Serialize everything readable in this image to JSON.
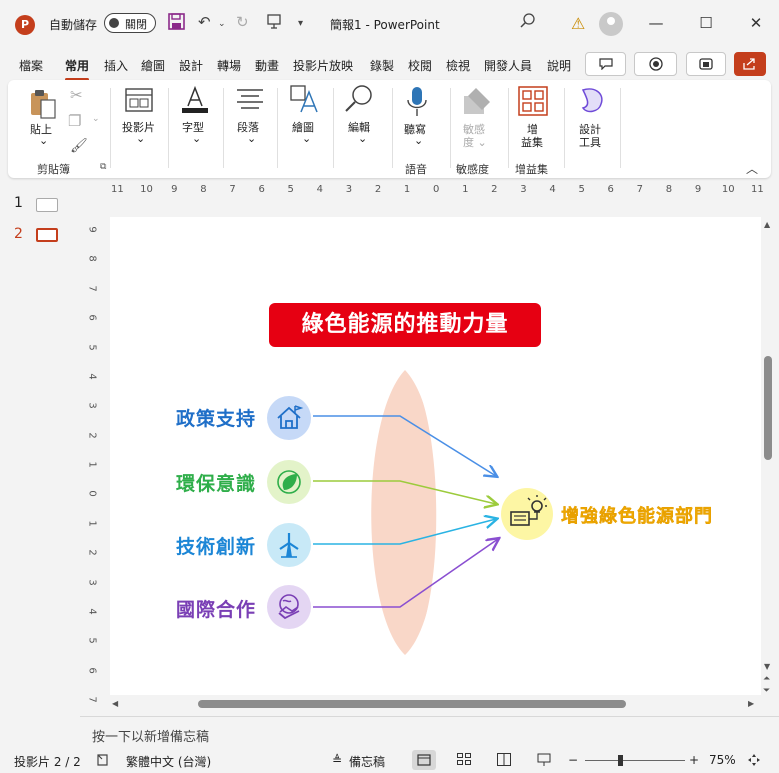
{
  "titlebar": {
    "app_logo": "P",
    "autosave_label": "自動儲存",
    "autosave_state": "關閉",
    "doc_title": "簡報1  -  PowerPoint"
  },
  "tabs": [
    "檔案",
    "常用",
    "插入",
    "繪圖",
    "設計",
    "轉場",
    "動畫",
    "投影片放映",
    "錄製",
    "校閱",
    "檢視",
    "開發人員",
    "說明"
  ],
  "active_tab": "常用",
  "ribbon": {
    "paste": "貼上",
    "clipboard_group": "剪貼簿",
    "slides": "投影片",
    "font": "字型",
    "paragraph": "段落",
    "drawing": "繪圖",
    "editing": "編輯",
    "dictate": "聽寫",
    "voice_group": "語音",
    "sensitivity_line1": "敏感",
    "sensitivity_line2": "度",
    "sensitivity_group": "敏感度",
    "addins_line1": "增",
    "addins_line2": "益集",
    "addins_group": "增益集",
    "designer_line1": "設計",
    "designer_line2": "工具"
  },
  "ruler": {
    "h_ticks": [
      "11",
      "10",
      "9",
      "8",
      "7",
      "6",
      "5",
      "4",
      "3",
      "2",
      "1",
      "0",
      "1",
      "2",
      "3",
      "4",
      "5",
      "6",
      "7",
      "8",
      "9",
      "10",
      "11"
    ],
    "v_ticks": [
      "9",
      "8",
      "7",
      "6",
      "5",
      "4",
      "3",
      "2",
      "1",
      "0",
      "1",
      "2",
      "3",
      "4",
      "5",
      "6",
      "7"
    ]
  },
  "thumbnails": [
    "1",
    "2"
  ],
  "slide": {
    "title": "綠色能源的推動力量",
    "items": [
      {
        "label": "政策支持",
        "color": "#1f6fc8",
        "circle": "#c6d9f7",
        "icon": "house-flag-icon"
      },
      {
        "label": "環保意識",
        "color": "#2fae4a",
        "circle": "#e3f3c9",
        "icon": "leaf-globe-icon"
      },
      {
        "label": "技術創新",
        "color": "#1c86d6",
        "circle": "#c8e9f7",
        "icon": "wind-turbine-icon"
      },
      {
        "label": "國際合作",
        "color": "#7a3fb5",
        "circle": "#e4d6f3",
        "icon": "handshake-globe-icon"
      }
    ],
    "target": {
      "label": "增強綠色能源部門",
      "color": "#ffc000",
      "circle": "#fdf6a4",
      "icon": "solar-panel-bulb-icon"
    },
    "lens_color": "#f9d7c8"
  },
  "notes_placeholder": "按一下以新增備忘稿",
  "status": {
    "slide_counter": "投影片 2 / 2",
    "language": "繁體中文 (台灣)",
    "notes_button": "備忘稿",
    "zoom": "75%"
  }
}
